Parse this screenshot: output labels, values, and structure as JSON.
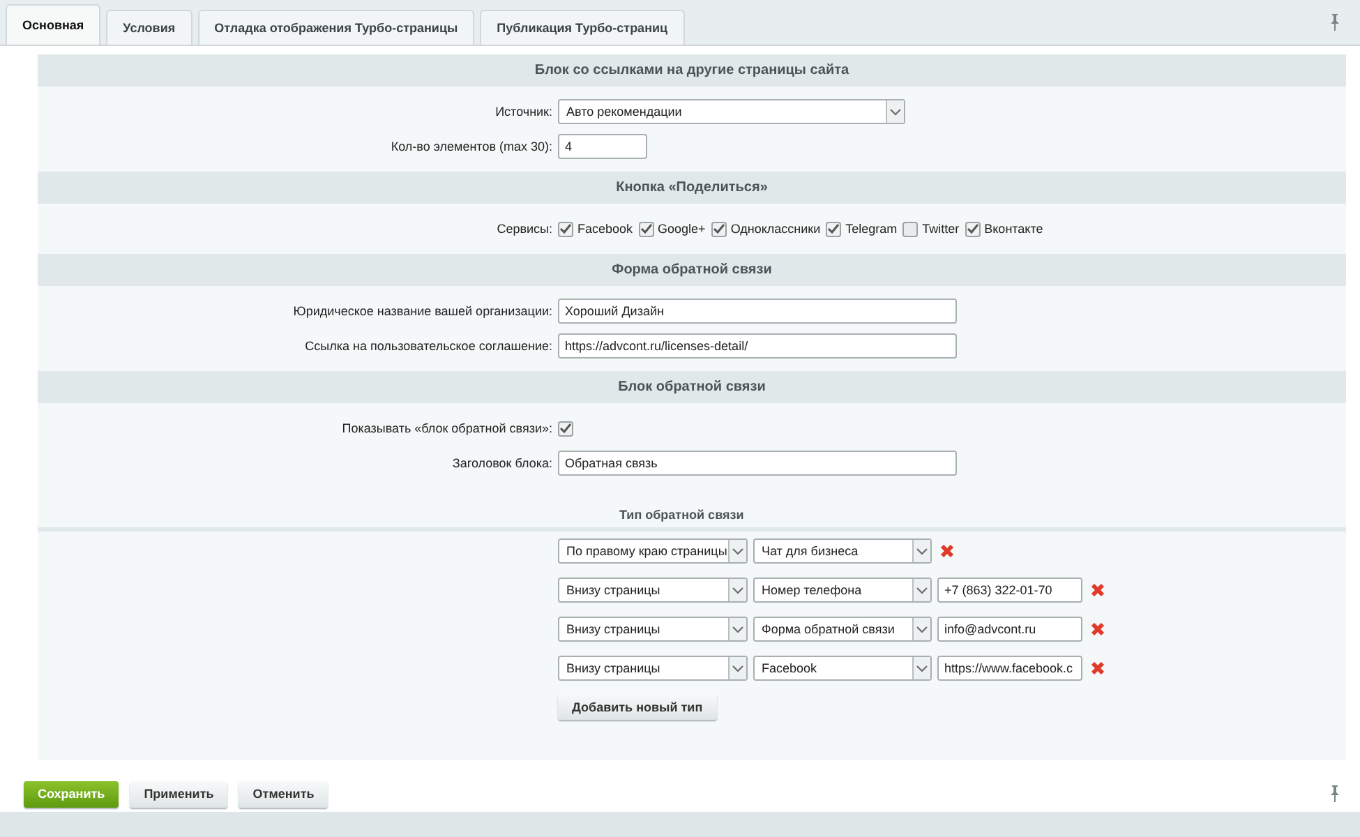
{
  "tabs": [
    {
      "label": "Основная",
      "selected": true
    },
    {
      "label": "Условия",
      "selected": false
    },
    {
      "label": "Отладка отображения Турбо-страницы",
      "selected": false
    },
    {
      "label": "Публикация Турбо-страниц",
      "selected": false
    }
  ],
  "sections": [
    {
      "title": "Блок со ссылками на другие страницы сайта",
      "fields": [
        {
          "kind": "select",
          "label": "Источник:",
          "value": "Авто рекомендации"
        },
        {
          "kind": "number",
          "label": "Кол-во элементов (max 30):",
          "value": "4"
        }
      ]
    },
    {
      "title": "Кнопка «Поделиться»",
      "fields": [
        {
          "kind": "checkboxes",
          "label": "Сервисы:",
          "options": [
            {
              "label": "Facebook",
              "checked": true
            },
            {
              "label": "Google+",
              "checked": true
            },
            {
              "label": "Одноклассники",
              "checked": true
            },
            {
              "label": "Telegram",
              "checked": true
            },
            {
              "label": "Twitter",
              "checked": false
            },
            {
              "label": "Вконтакте",
              "checked": true
            }
          ]
        }
      ]
    },
    {
      "title": "Форма обратной связи",
      "fields": [
        {
          "kind": "input",
          "label": "Юридическое название вашей организации:",
          "value": "Хороший Дизайн"
        },
        {
          "kind": "input",
          "label": "Ссылка на пользовательское соглашение:",
          "value": "https://advcont.ru/licenses-detail/"
        }
      ]
    },
    {
      "title": "Блок обратной связи",
      "fields": [
        {
          "kind": "checkbox",
          "label": "Показывать «блок обратной связи»:",
          "checked": true
        },
        {
          "kind": "input",
          "label": "Заголовок блока:",
          "value": "Обратная связь"
        }
      ]
    }
  ],
  "feedback_types": {
    "title": "Тип обратной связи",
    "rows": [
      {
        "position": "По правому краю страницы",
        "type": "Чат для бизнеса"
      },
      {
        "position": "Внизу страницы",
        "type": "Номер телефона",
        "value": "+7 (863) 322-01-70"
      },
      {
        "position": "Внизу страницы",
        "type": "Форма обратной связи",
        "value": "info@advcont.ru"
      },
      {
        "position": "Внизу страницы",
        "type": "Facebook",
        "value": "https://www.facebook.c"
      }
    ],
    "add_button": "Добавить новый тип"
  },
  "buttons": [
    {
      "label": "Сохранить",
      "kind": "primary"
    },
    {
      "label": "Применить",
      "kind": "normal"
    },
    {
      "label": "Отменить",
      "kind": "normal"
    }
  ]
}
